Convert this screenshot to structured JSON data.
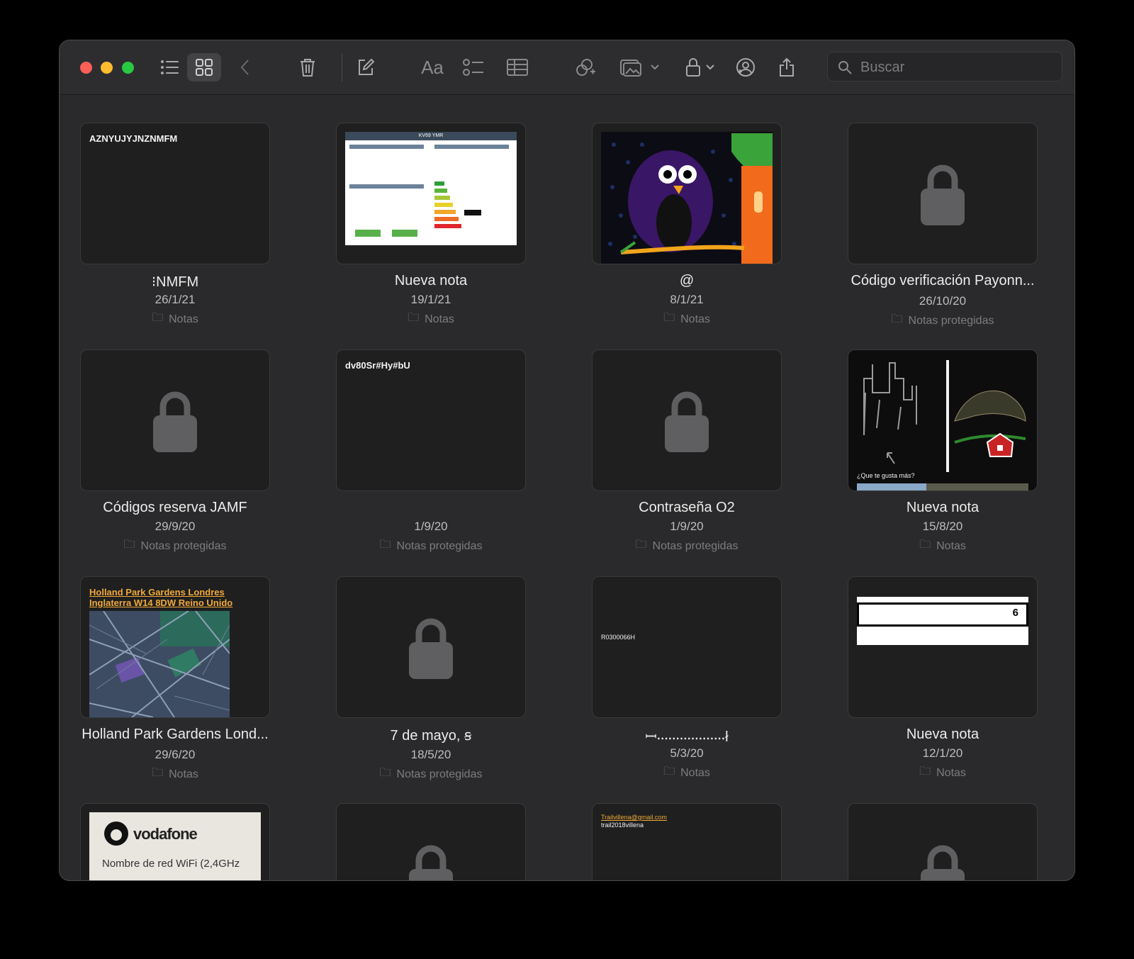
{
  "toolbar": {
    "search_placeholder": "Buscar"
  },
  "prev_row_folders": [
    "Notas",
    "Notas",
    "Notas",
    "Notas"
  ],
  "notes": [
    {
      "title": "⁝NMFM",
      "date": "26/1/21",
      "folder": "Notas",
      "snippet": "AZNYUJYJNZNMFM"
    },
    {
      "title": "Nueva nota",
      "date": "19/1/21",
      "folder": "Notas",
      "snippet": "KV69 YMR"
    },
    {
      "title": "@",
      "date": "8/1/21",
      "folder": "Notas"
    },
    {
      "title": "Código verificación Payonn...",
      "date": "26/10/20",
      "folder": "Notas protegidas"
    },
    {
      "title": "Códigos reserva JAMF",
      "date": "29/9/20",
      "folder": "Notas protegidas"
    },
    {
      "title": "",
      "date": "1/9/20",
      "folder": "Notas protegidas",
      "snippet": "dv80Sr#Hy#bU"
    },
    {
      "title": "Contraseña O2",
      "date": "1/9/20",
      "folder": "Notas protegidas"
    },
    {
      "title": "Nueva nota",
      "date": "15/8/20",
      "folder": "Notas",
      "snippet": "¿Que te gusta más?"
    },
    {
      "title": "Holland Park Gardens Lond...",
      "date": "29/6/20",
      "folder": "Notas",
      "snippet": "Holland Park Gardens Londres Inglaterra W14 8DW Reino Unido"
    },
    {
      "title": "7 de mayo, ꞩ",
      "date": "18/5/20",
      "folder": "Notas protegidas"
    },
    {
      "title": "ꟷ⸳⸳⸳⸳⸳⸳⸳⸳⸳⸳⸳⸳⸳⸳⸳⸳⸳⸳ł",
      "date": "5/3/20",
      "folder": "Notas",
      "snippet": "R0300066H"
    },
    {
      "title": "Nueva nota",
      "date": "12/1/20",
      "folder": "Notas",
      "snippet": "6"
    },
    {
      "snippet": "vodafone",
      "snippet2": "Nombre de red WiFi (2,4GHz"
    },
    {},
    {
      "snippet": "Trailvillena@gmail.com",
      "snippet2": "trail2018villena"
    },
    {}
  ]
}
